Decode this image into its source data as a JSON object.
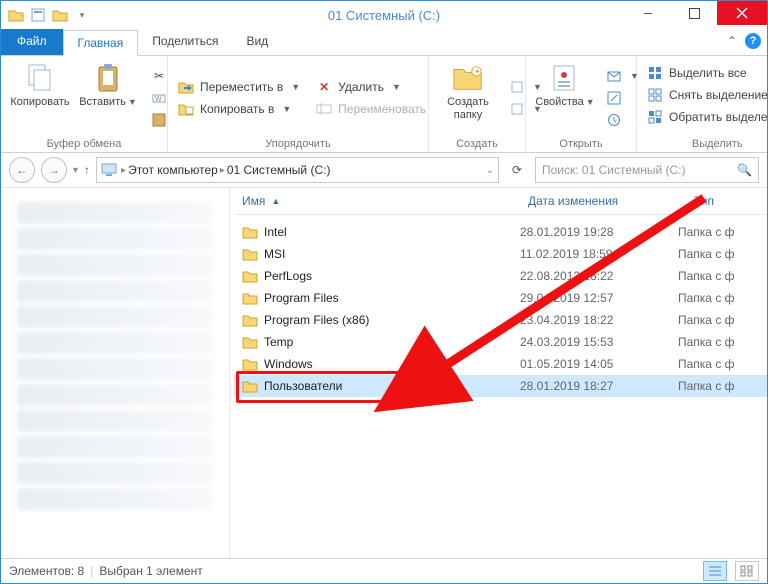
{
  "window": {
    "title": "01 Системный (C:)"
  },
  "tabs": {
    "file": "Файл",
    "home": "Главная",
    "share": "Поделиться",
    "view": "Вид"
  },
  "ribbon": {
    "clipboard": {
      "copy": "Копировать",
      "paste": "Вставить",
      "title": "Буфер обмена"
    },
    "organize": {
      "moveTo": "Переместить в",
      "copyTo": "Копировать в",
      "delete": "Удалить",
      "rename": "Переименовать",
      "title": "Упорядочить"
    },
    "new": {
      "newFolder": "Создать\nпапку",
      "title": "Создать"
    },
    "open": {
      "properties": "Свойства",
      "title": "Открыть"
    },
    "select": {
      "selectAll": "Выделить все",
      "selectNone": "Снять выделение",
      "invert": "Обратить выделение",
      "title": "Выделить"
    }
  },
  "breadcrumb": {
    "thisPc": "Этот компьютер",
    "drive": "01 Системный (C:)"
  },
  "search": {
    "placeholder": "Поиск: 01 Системный (C:)"
  },
  "columns": {
    "name": "Имя",
    "date": "Дата изменения",
    "type": "Тип"
  },
  "rowTypeLabel": "Папка с ф",
  "rows": [
    {
      "name": "Intel",
      "date": "28.01.2019 19:28"
    },
    {
      "name": "MSI",
      "date": "11.02.2019 18:59"
    },
    {
      "name": "PerfLogs",
      "date": "22.08.2013 18:22"
    },
    {
      "name": "Program Files",
      "date": "29.04.2019 12:57"
    },
    {
      "name": "Program Files (x86)",
      "date": "23.04.2019 18:22"
    },
    {
      "name": "Temp",
      "date": "24.03.2019 15:53"
    },
    {
      "name": "Windows",
      "date": "01.05.2019 14:05"
    },
    {
      "name": "Пользователи",
      "date": "28.01.2019 18:27",
      "selected": true,
      "highlighted": true
    }
  ],
  "status": {
    "count": "Элементов: 8",
    "selected": "Выбран 1 элемент"
  }
}
